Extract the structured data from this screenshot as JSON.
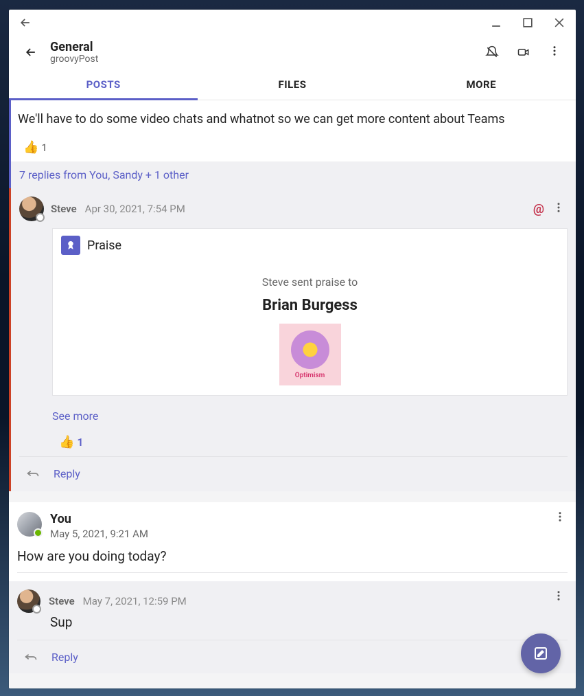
{
  "header": {
    "title": "General",
    "subtitle": "groovyPost"
  },
  "tabs": {
    "posts": "POSTS",
    "files": "FILES",
    "more": "MORE"
  },
  "threadTop": {
    "message": "We'll have to do some video chats and whatnot so we can get more content about Teams",
    "reactionEmoji": "👍",
    "reactionCount": "1"
  },
  "repliesSummary": "7 replies from You, Sandy + 1 other",
  "praiseReply": {
    "sender": "Steve",
    "timestamp": "Apr 30, 2021, 7:54 PM",
    "mentionSymbol": "@",
    "cardTitle": "Praise",
    "subtitle": "Steve sent praise to",
    "recipient": "Brian Burgess",
    "badgeLabel": "Optimism",
    "seeMore": "See more",
    "reactionEmoji": "👍",
    "reactionCount": "1",
    "replyLabel": "Reply"
  },
  "post": {
    "sender": "You",
    "timestamp": "May 5, 2021, 9:21 AM",
    "body": "How are you doing today?"
  },
  "subreply": {
    "sender": "Steve",
    "timestamp": "May 7, 2021, 12:59 PM",
    "body": "Sup",
    "replyLabel": "Reply"
  }
}
